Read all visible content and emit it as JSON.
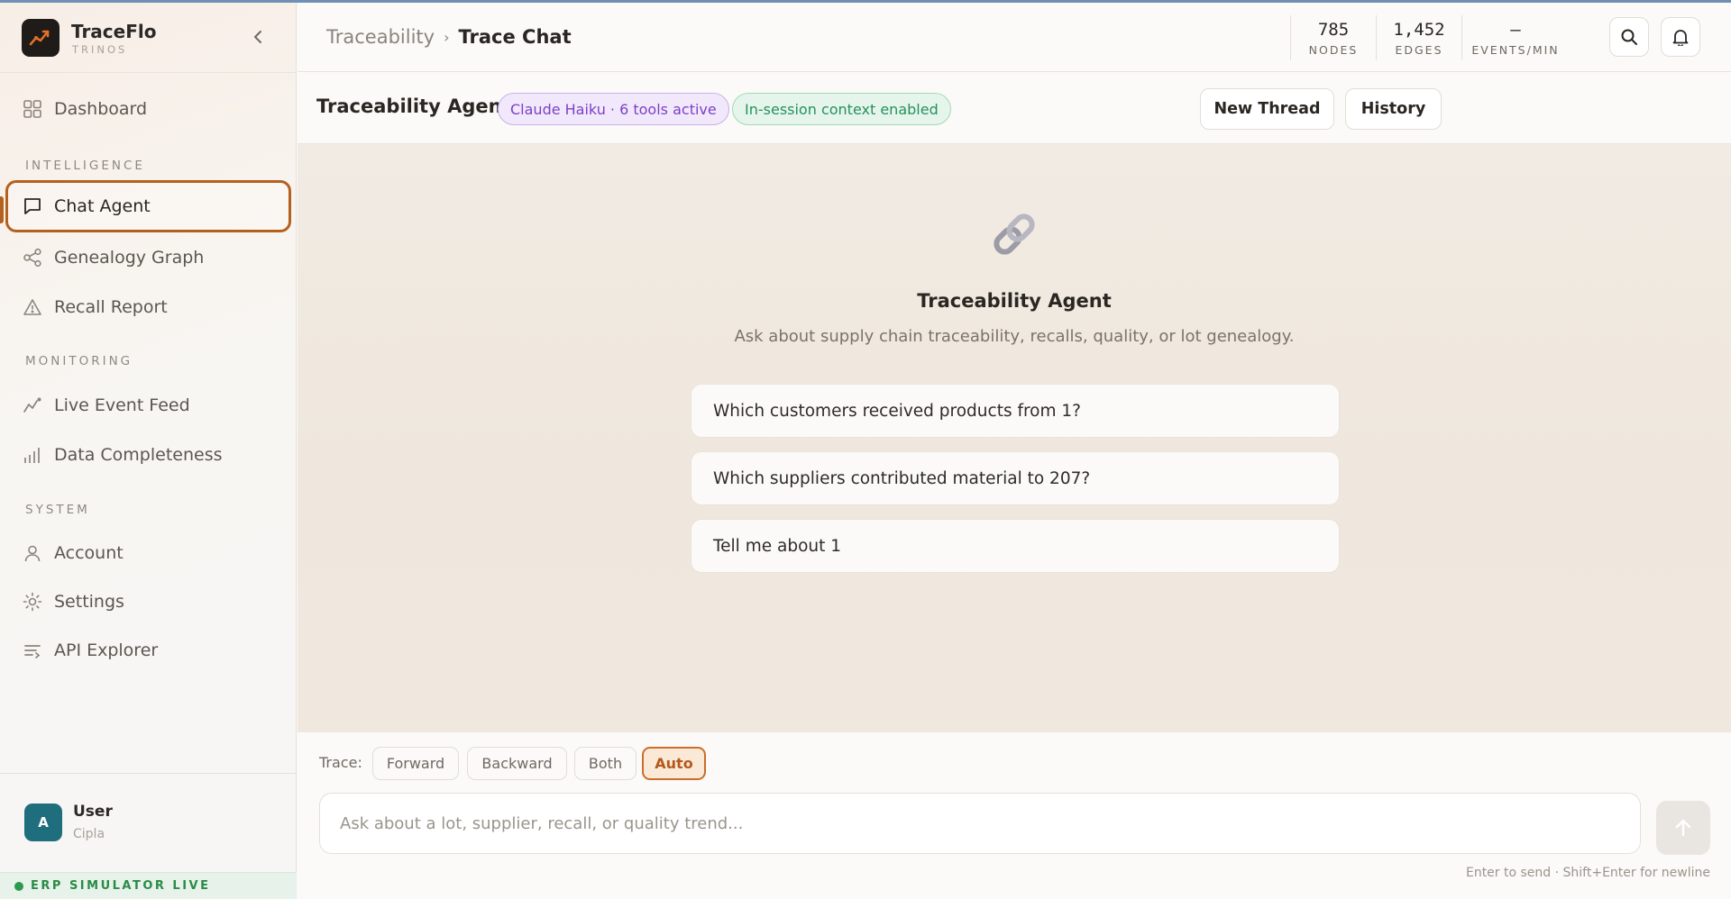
{
  "brand": {
    "name": "TraceFlo",
    "sub": "TRINOS"
  },
  "sidebar": {
    "dashboard": "Dashboard",
    "sections": [
      {
        "label": "INTELLIGENCE",
        "items": [
          "Chat Agent",
          "Genealogy Graph",
          "Recall Report"
        ]
      },
      {
        "label": "MONITORING",
        "items": [
          "Live Event Feed",
          "Data Completeness"
        ]
      },
      {
        "label": "SYSTEM",
        "items": [
          "Account",
          "Settings",
          "API Explorer"
        ]
      }
    ],
    "active_item": "Chat Agent"
  },
  "user": {
    "initial": "A",
    "name": "User",
    "org": "Cipla"
  },
  "erp_status": "ERP SIMULATOR LIVE",
  "header": {
    "breadcrumb_parent": "Traceability",
    "breadcrumb_sep": "›",
    "breadcrumb_current": "Trace Chat",
    "stats": [
      {
        "value": "785",
        "label": "NODES"
      },
      {
        "value": "1,452",
        "label": "EDGES"
      },
      {
        "value": "–",
        "label": "EVENTS/MIN"
      }
    ]
  },
  "agent": {
    "title": "Traceability Agent",
    "model_badge": "Claude Haiku · 6 tools active",
    "context_badge": "In-session context enabled",
    "new_thread": "New Thread",
    "history": "History"
  },
  "hero": {
    "icon": "link-icon",
    "title": "Traceability Agent",
    "subtitle": "Ask about supply chain traceability, recalls, quality, or lot genealogy."
  },
  "suggestions": [
    "Which customers received products from 1?",
    "Which suppliers contributed material to 207?",
    "Tell me about 1"
  ],
  "composer": {
    "trace_label": "Trace:",
    "modes": [
      "Forward",
      "Backward",
      "Both",
      "Auto"
    ],
    "active_mode": "Auto",
    "placeholder": "Ask about a lot, supplier, recall, or quality trend...",
    "value": "",
    "hint": "Enter to send · Shift+Enter for newline"
  },
  "colors": {
    "accent": "#b4601f",
    "badge_purple": "#7d3fc8",
    "badge_green": "#26915a",
    "live_green": "#2b9a4f",
    "avatar": "#1f6e7d"
  }
}
